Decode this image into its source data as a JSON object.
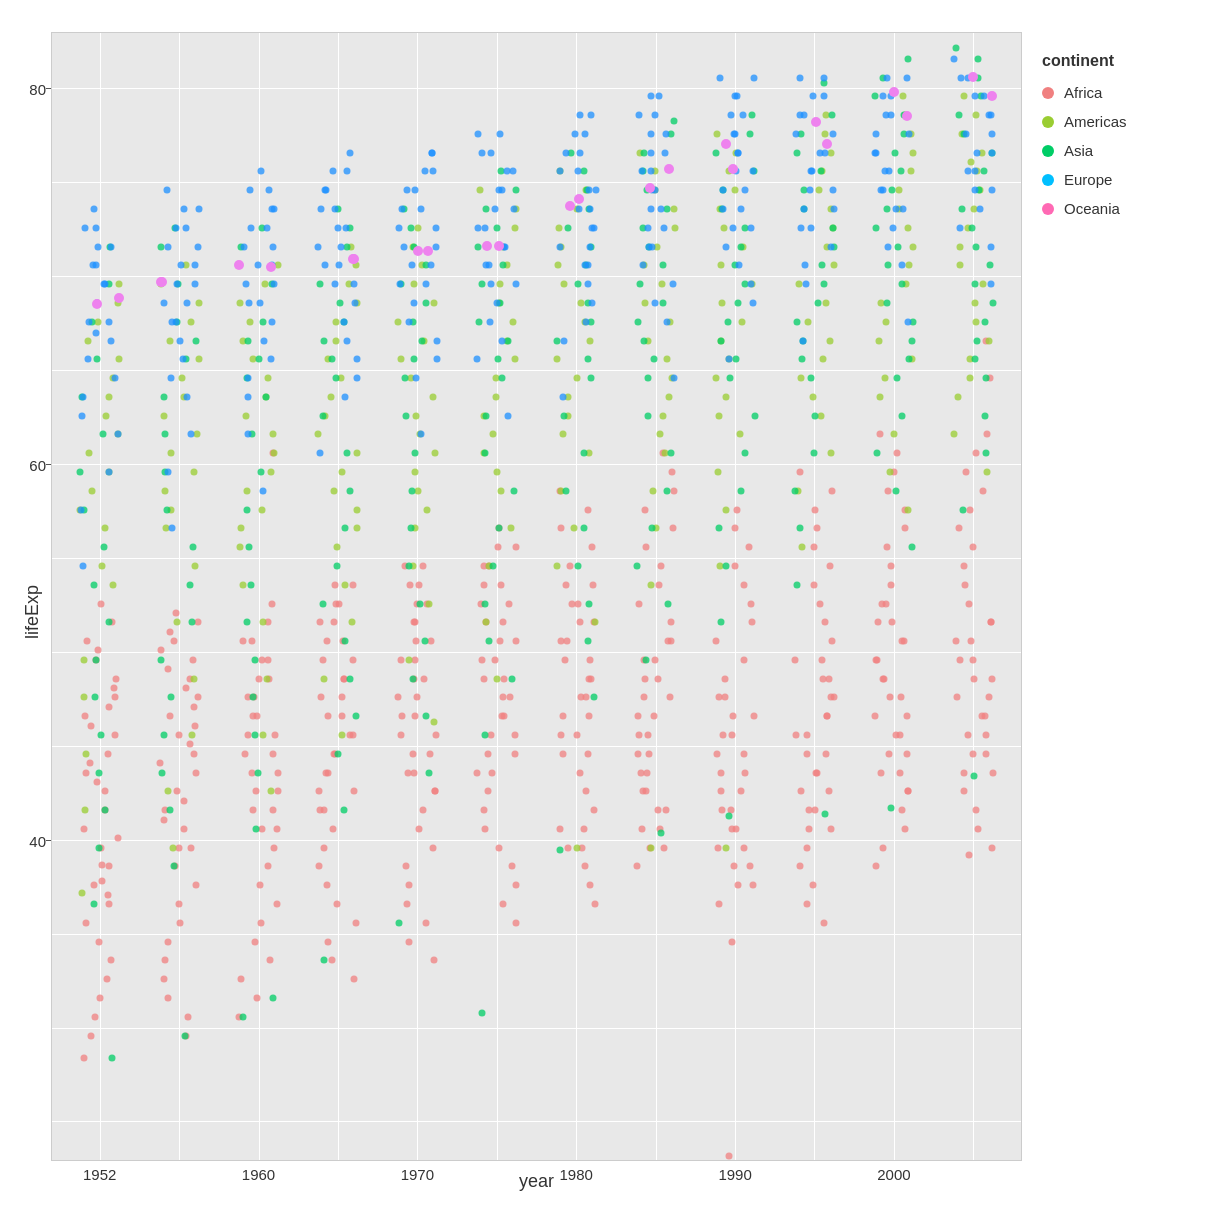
{
  "chart": {
    "title": "",
    "x_axis_label": "year",
    "y_axis_label": "lifeExp",
    "legend_title": "continent",
    "plot_background": "#e8e8e8",
    "grid_color": "#ffffff"
  },
  "axes": {
    "y_ticks": [
      {
        "value": 80,
        "label": "80"
      },
      {
        "value": 60,
        "label": "60"
      },
      {
        "value": 40,
        "label": "40"
      }
    ],
    "y_min": 23,
    "y_max": 83,
    "x_ticks": [
      {
        "value": 1952,
        "label": "1952"
      },
      {
        "value": 1957,
        "label": ""
      },
      {
        "value": 1962,
        "label": "1960"
      },
      {
        "value": 1967,
        "label": ""
      },
      {
        "value": 1972,
        "label": "1970"
      },
      {
        "value": 1977,
        "label": ""
      },
      {
        "value": 1982,
        "label": "1980"
      },
      {
        "value": 1987,
        "label": ""
      },
      {
        "value": 1992,
        "label": "1990"
      },
      {
        "value": 1997,
        "label": ""
      },
      {
        "value": 2002,
        "label": "2000"
      },
      {
        "value": 2007,
        "label": ""
      }
    ],
    "x_min": 1949,
    "x_max": 2010
  },
  "legend": {
    "items": [
      {
        "label": "Africa",
        "color": "#F08080"
      },
      {
        "label": "Americas",
        "color": "#9ACD32"
      },
      {
        "label": "Asia",
        "color": "#00CD66"
      },
      {
        "label": "Europe",
        "color": "#00BFFF"
      },
      {
        "label": "Oceania",
        "color": "#FF69B4"
      }
    ]
  },
  "continents": {
    "Africa": {
      "color": "#F08080",
      "alpha": 0.8
    },
    "Americas": {
      "color": "#9ACD32",
      "alpha": 0.8
    },
    "Asia": {
      "color": "#00CD66",
      "alpha": 0.8
    },
    "Europe": {
      "color": "#00BFFF",
      "alpha": 0.8
    },
    "Oceania": {
      "color": "#FF69B4",
      "alpha": 0.9
    }
  }
}
